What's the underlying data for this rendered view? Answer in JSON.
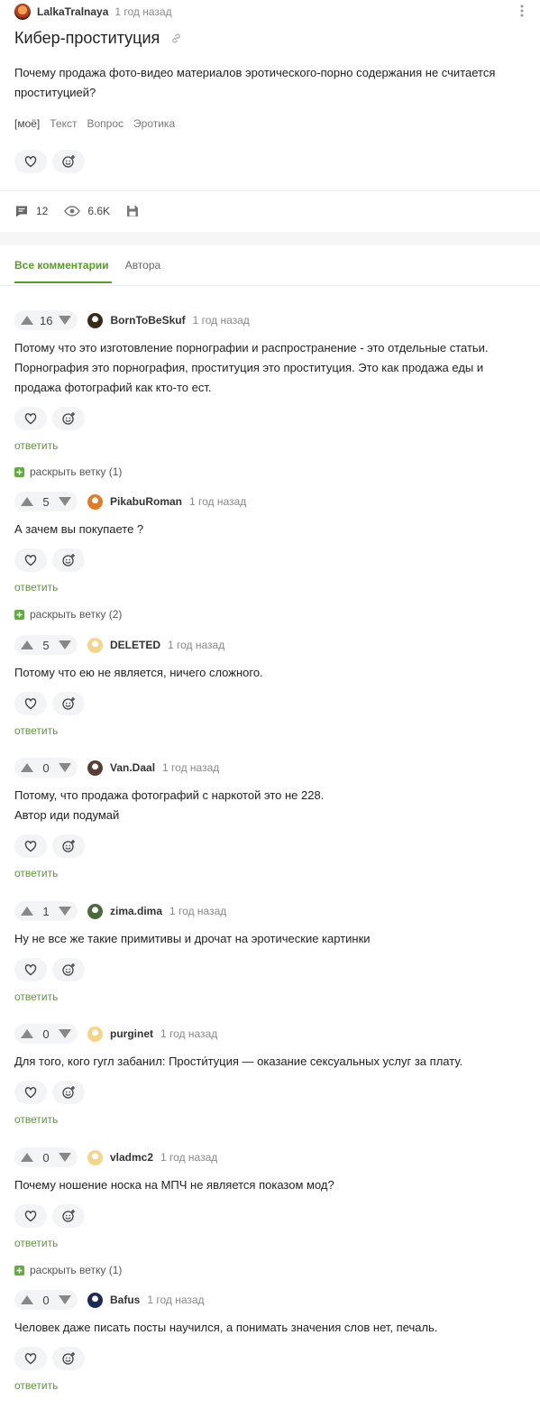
{
  "post": {
    "author": "LalkaTralnaya",
    "time": "1 год назад",
    "title": "Кибер-проституция",
    "body": "Почему продажа фото-видео материалов эротического-порно содержания не считается проституцией?",
    "tags": [
      "[моё]",
      "Текст",
      "Вопрос",
      "Эротика"
    ],
    "comments_count": "12",
    "views": "6.6K"
  },
  "tabs": {
    "all": "Все комментарии",
    "author": "Автора"
  },
  "labels": {
    "reply": "ответить"
  },
  "comments": [
    {
      "votes": "16",
      "author": "BornToBeSkuf",
      "time": "1 год назад",
      "avatar_color": "#3a2a1a",
      "text": "Потому что это изготовление порнографии и распространение - это отдельные статьи. Порнография это порнография, проституция это проституция. Это как продажа еды и продажа фотографий как кто-то ест.",
      "expand": "раскрыть ветку (1)"
    },
    {
      "votes": "5",
      "author": "PikabuRoman",
      "time": "1 год назад",
      "avatar_color": "#e07b2a",
      "text": "А зачем вы покупаете ?",
      "expand": "раскрыть ветку (2)"
    },
    {
      "votes": "5",
      "author": "DELETED",
      "time": "1 год назад",
      "avatar_color": "#f5d58a",
      "text": "Потому что ею не является, ничего сложного."
    },
    {
      "votes": "0",
      "author": "Van.Daal",
      "time": "1 год назад",
      "avatar_color": "#5a3e33",
      "text": "Потому, что продажа фотографий с наркотой это не 228.\nАвтор иди подумай"
    },
    {
      "votes": "1",
      "author": "zima.dima",
      "time": "1 год назад",
      "avatar_color": "#4a6a3a",
      "text": "Ну не все же такие примитивы и дрочат на эротические картинки"
    },
    {
      "votes": "0",
      "author": "purginet",
      "time": "1 год назад",
      "avatar_color": "#f5d58a",
      "text": "Для того, кого гугл забанил: Прости́туция — оказание сексуальных услуг за плату."
    },
    {
      "votes": "0",
      "author": "vladmc2",
      "time": "1 год назад",
      "avatar_color": "#f5d58a",
      "text": "Почему ношение носка на МПЧ не является показом мод?",
      "expand": "раскрыть ветку (1)"
    },
    {
      "votes": "0",
      "author": "Bafus",
      "time": "1 год назад",
      "avatar_color": "#1a2a5a",
      "text": "Человек даже писать посты научился, а понимать значения слов нет, печаль."
    }
  ],
  "colors": {
    "accent": "#5a9a2e",
    "pill_bg": "#f3f4f5",
    "expand_plus": "#67a94a"
  }
}
